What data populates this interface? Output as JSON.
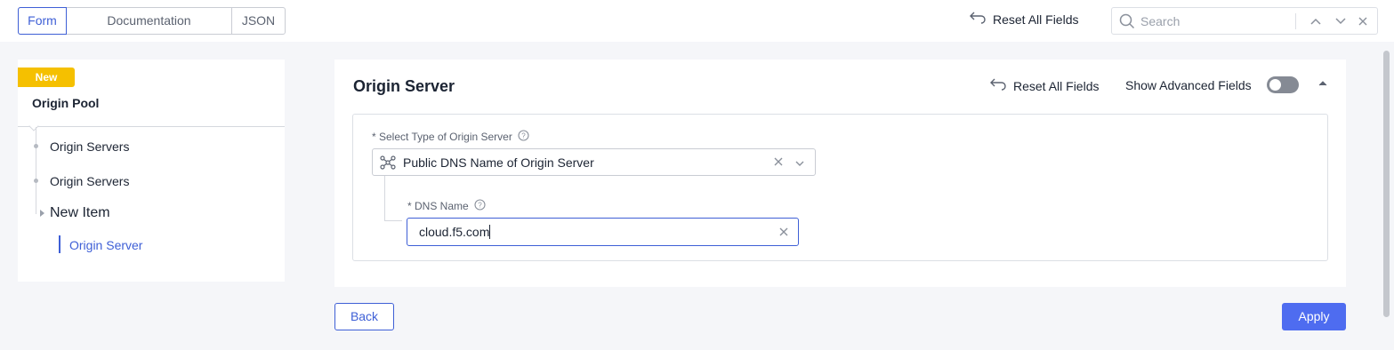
{
  "tabs": [
    {
      "label": "Form",
      "active": true
    },
    {
      "label": "Documentation",
      "active": false
    },
    {
      "label": "JSON",
      "active": false
    }
  ],
  "toolbar": {
    "reset_label": "Reset All Fields",
    "search_placeholder": "Search"
  },
  "sidebar": {
    "badge": "New",
    "title": "Origin Pool",
    "items": [
      {
        "label": "Origin Servers"
      },
      {
        "label": "Origin Servers"
      },
      {
        "label": "New Item"
      },
      {
        "label": "Origin Server",
        "active": true
      }
    ]
  },
  "card": {
    "title": "Origin Server",
    "reset_label": "Reset All Fields",
    "advanced_label": "Show Advanced Fields",
    "advanced_enabled": false,
    "type_label": "* Select Type of Origin Server",
    "type_value": "Public DNS Name of Origin Server",
    "dns_label": "* DNS Name",
    "dns_value": "cloud.f5.com"
  },
  "buttons": {
    "back": "Back",
    "apply": "Apply"
  },
  "colors": {
    "accent": "#3e5fd6",
    "apply_bg": "#4e6cf0",
    "badge": "#f5c000"
  }
}
